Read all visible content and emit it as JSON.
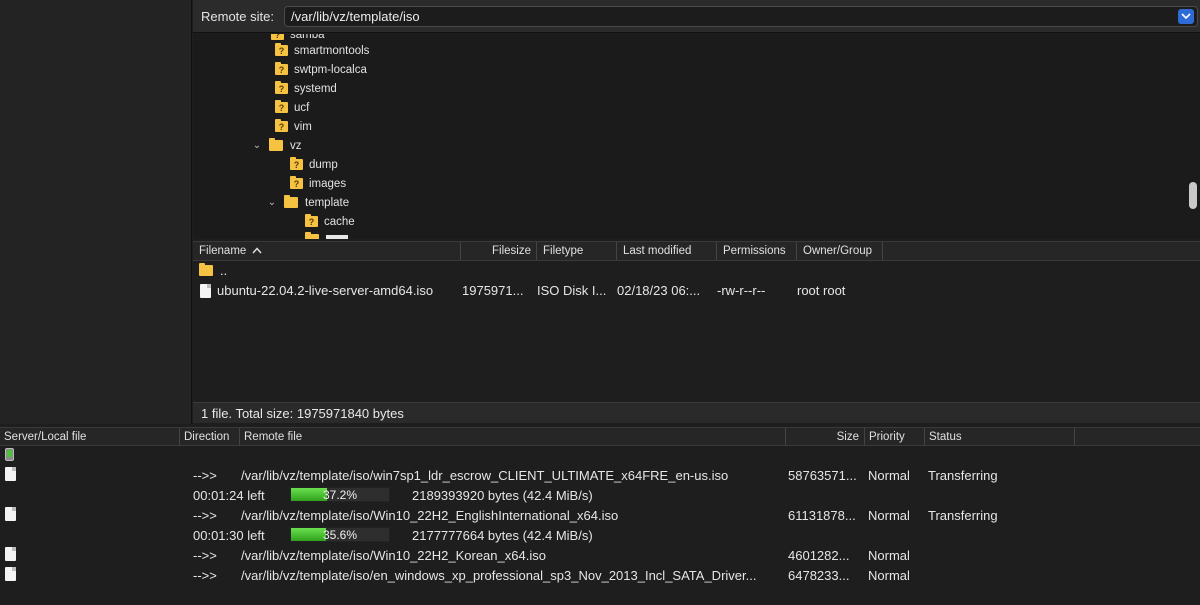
{
  "remote": {
    "label": "Remote site:",
    "path": "/var/lib/vz/template/iso"
  },
  "tree": {
    "items": [
      {
        "label": "samba",
        "kind": "unknown",
        "depth": 1
      },
      {
        "label": "smartmontools",
        "kind": "unknown",
        "depth": 1
      },
      {
        "label": "swtpm-localca",
        "kind": "unknown",
        "depth": 1
      },
      {
        "label": "systemd",
        "kind": "unknown",
        "depth": 1
      },
      {
        "label": "ucf",
        "kind": "unknown",
        "depth": 1
      },
      {
        "label": "vim",
        "kind": "unknown",
        "depth": 1
      },
      {
        "label": "vz",
        "kind": "open",
        "depth": 1
      },
      {
        "label": "dump",
        "kind": "unknown",
        "depth": 2
      },
      {
        "label": "images",
        "kind": "unknown",
        "depth": 2
      },
      {
        "label": "template",
        "kind": "open",
        "depth": 2
      },
      {
        "label": "cache",
        "kind": "unknown",
        "depth": 3
      }
    ]
  },
  "file_list": {
    "columns": [
      "Filename",
      "Filesize",
      "Filetype",
      "Last modified",
      "Permissions",
      "Owner/Group"
    ],
    "rows": [
      {
        "name": "..",
        "size": "",
        "type": "",
        "modified": "",
        "perms": "",
        "owner": "",
        "is_dir": true
      },
      {
        "name": "ubuntu-22.04.2-live-server-amd64.iso",
        "size": "1975971...",
        "type": "ISO Disk I...",
        "modified": "02/18/23 06:...",
        "perms": "-rw-r--r--",
        "owner": "root root",
        "is_dir": false
      }
    ]
  },
  "status": {
    "text": "1 file. Total size: 1975971840 bytes"
  },
  "queue": {
    "columns": [
      "Server/Local file",
      "Direction",
      "Remote file",
      "Size",
      "Priority",
      "Status"
    ],
    "items": [
      {
        "direction": "-->>",
        "remote": "/var/lib/vz/template/iso/win7sp1_ldr_escrow_CLIENT_ULTIMATE_x64FRE_en-us.iso",
        "size": "58763571...",
        "priority": "Normal",
        "status": "Transferring",
        "progress": {
          "left": "00:01:24 left",
          "percent": 37.2,
          "percent_label": "37.2%",
          "bytes": "2189393920 bytes (42.4 MiB/s)"
        }
      },
      {
        "direction": "-->>",
        "remote": "/var/lib/vz/template/iso/Win10_22H2_EnglishInternational_x64.iso",
        "size": "61131878...",
        "priority": "Normal",
        "status": "Transferring",
        "progress": {
          "left": "00:01:30 left",
          "percent": 35.6,
          "percent_label": "35.6%",
          "bytes": "2177777664 bytes (42.4 MiB/s)"
        }
      },
      {
        "direction": "-->>",
        "remote": "/var/lib/vz/template/iso/Win10_22H2_Korean_x64.iso",
        "size": "4601282...",
        "priority": "Normal",
        "status": ""
      },
      {
        "direction": "-->>",
        "remote": "/var/lib/vz/template/iso/en_windows_xp_professional_sp3_Nov_2013_Incl_SATA_Driver...",
        "size": "6478233...",
        "priority": "Normal",
        "status": ""
      }
    ]
  }
}
